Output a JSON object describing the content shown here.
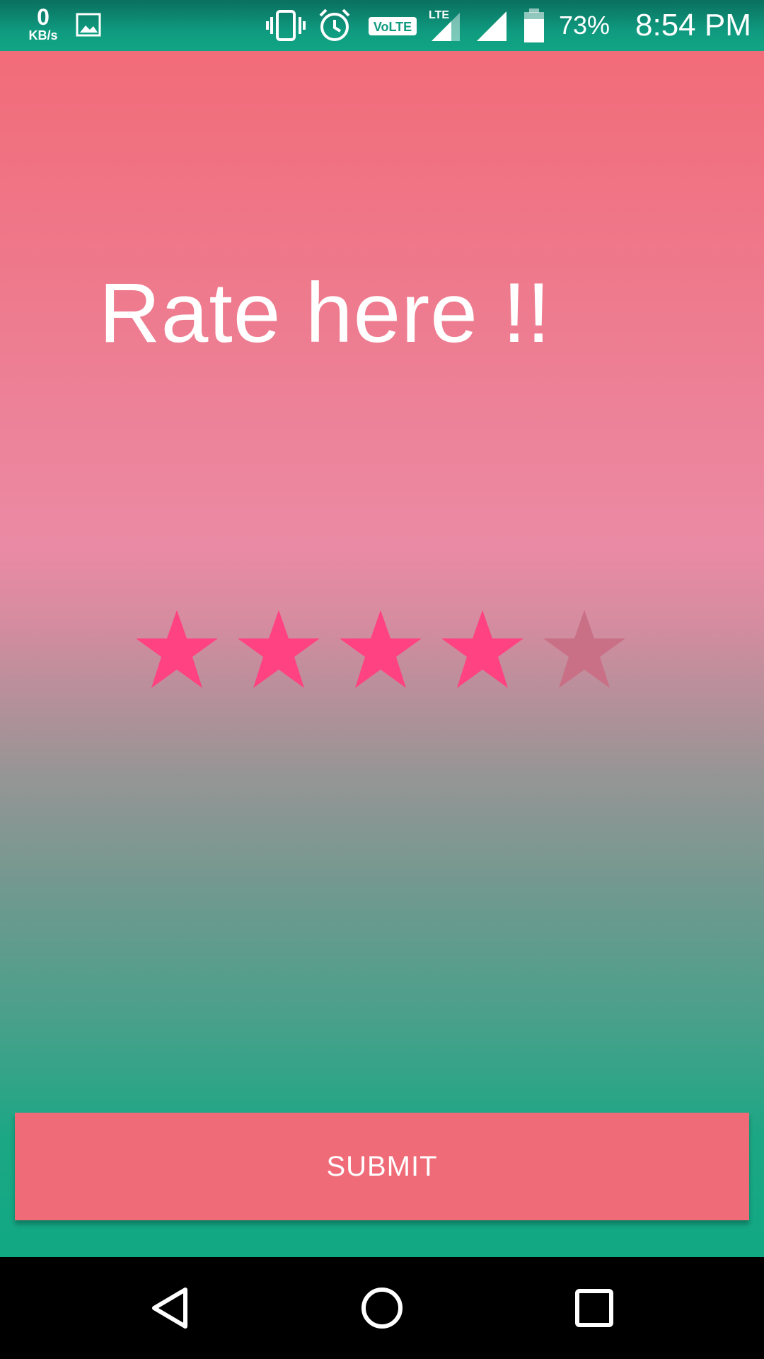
{
  "status_bar": {
    "net_speed_value": "0",
    "net_speed_unit": "KB/s",
    "icons": [
      "gallery-icon",
      "vibrate-icon",
      "alarm-icon",
      "volte-icon",
      "lte-signal-icon",
      "signal-icon",
      "battery-icon"
    ],
    "volte_label": "VoLTE",
    "lte_label": "LTE",
    "battery_percent": "73%",
    "time": "8:54 PM"
  },
  "screen": {
    "title": "Rate here !!",
    "rating": {
      "max": 5,
      "value": 4,
      "filled_color": "#ff4281",
      "empty_color": "#c96f86"
    },
    "submit_label": "SUBMIT"
  },
  "colors": {
    "status_bar": "#0f9a7f",
    "gradient_top": "#f26c79",
    "gradient_mid": "#eb8aa4",
    "gradient_bottom": "#11a884",
    "button": "#f06b78"
  },
  "nav_bar": {
    "buttons": [
      "back-icon",
      "home-icon",
      "recents-icon"
    ]
  }
}
